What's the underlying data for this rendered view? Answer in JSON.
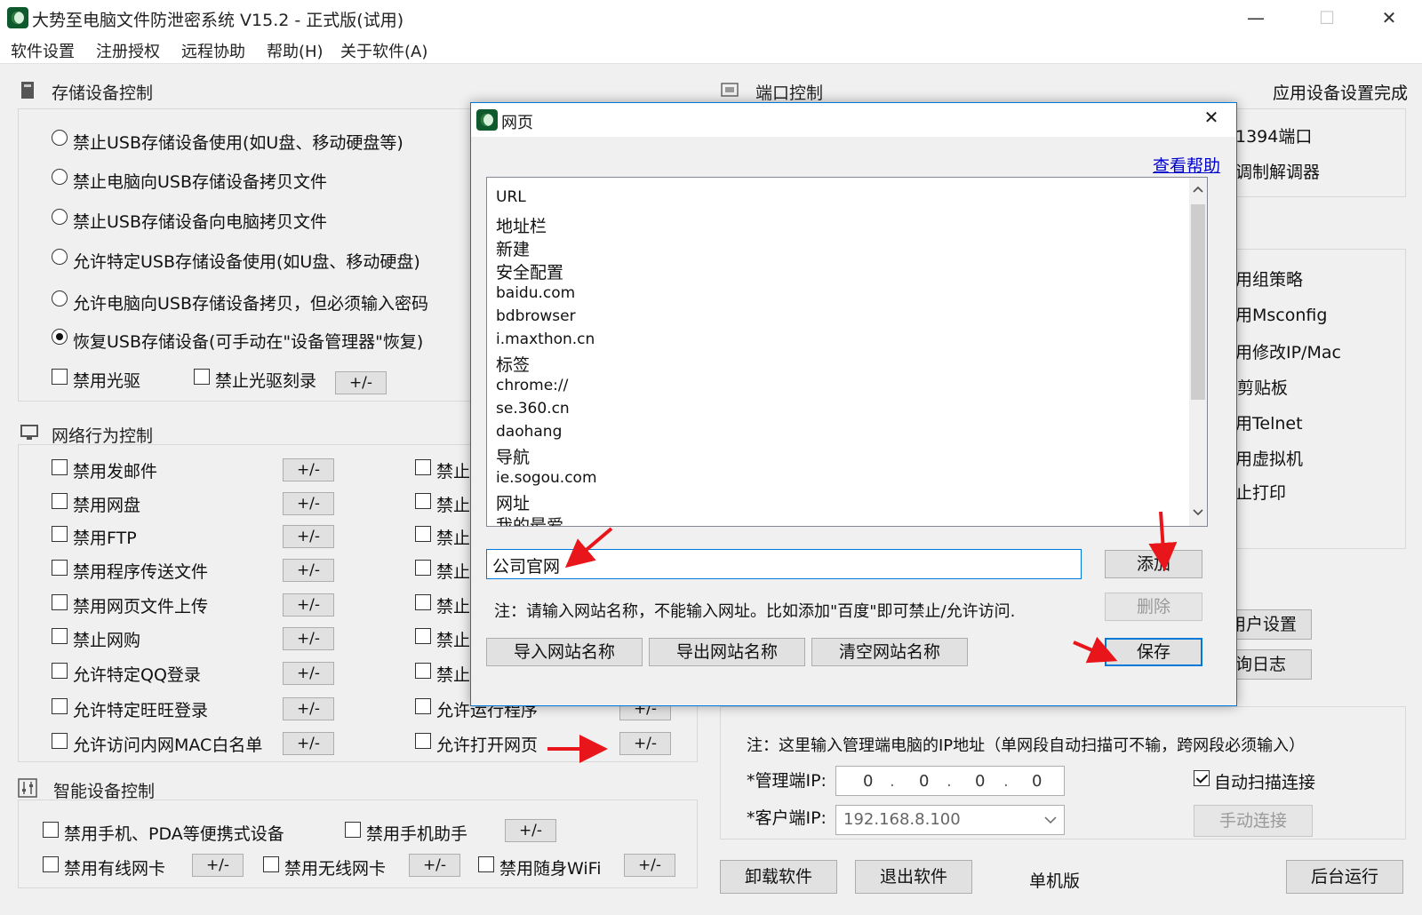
{
  "window": {
    "title": "大势至电脑文件防泄密系统 V15.2 - 正式版(试用)",
    "minimize": "—",
    "maximize": "☐",
    "close": "✕"
  },
  "menu": [
    "软件设置",
    "注册授权",
    "远程协助",
    "帮助(H)",
    "关于软件(A)"
  ],
  "storage": {
    "title": "存储设备控制",
    "options": [
      {
        "label": "禁止USB存储设备使用(如U盘、移动硬盘等)",
        "selected": false
      },
      {
        "label": "禁止电脑向USB存储设备拷贝文件",
        "selected": false
      },
      {
        "label": "禁止USB存储设备向电脑拷贝文件",
        "selected": false
      },
      {
        "label": "允许特定USB存储设备使用(如U盘、移动硬盘)",
        "selected": false
      },
      {
        "label": "允许电脑向USB存储设备拷贝，但必须输入密码",
        "selected": false
      },
      {
        "label": "恢复USB存储设备(可手动在\"设备管理器\"恢复)",
        "selected": true
      }
    ],
    "disable_cdrom": "禁用光驱",
    "disable_burn": "禁止光驱刻录",
    "pm": "+/-"
  },
  "network": {
    "title": "网络行为控制",
    "left_items": [
      "禁用发邮件",
      "禁用网盘",
      "禁用FTP",
      "禁用程序传送文件",
      "禁用网页文件上传",
      "禁止网购",
      "允许特定QQ登录",
      "允许特定旺旺登录",
      "允许访问内网MAC白名单"
    ],
    "right_prefix": "禁止",
    "right_items_last": [
      "允许运行程序",
      "允许打开网页"
    ],
    "pm": "+/-"
  },
  "smart": {
    "title": "智能设备控制",
    "row1": [
      "禁用手机、PDA等便携式设备",
      "禁用手机助手"
    ],
    "row2": [
      "禁用有线网卡",
      "禁用无线网卡",
      "禁用随身WiFi"
    ],
    "pm": "+/-"
  },
  "port": {
    "title": "端口控制",
    "status": "应用设备设置完成",
    "items": [
      "1394端口",
      "调制解调器"
    ]
  },
  "system": {
    "items": [
      "用组策略",
      "用Msconfig",
      "用修改IP/Mac",
      "剪贴板",
      "用Telnet",
      "用虚拟机",
      "止打印"
    ]
  },
  "right_buttons": [
    "用户设置",
    "询日志"
  ],
  "connect": {
    "note": "注：这里输入管理端电脑的IP地址（单网段自动扫描可不输，跨网段必须输入）",
    "admin_label": "*管理端IP:",
    "admin_ip": [
      "0",
      "0",
      "0",
      "0"
    ],
    "client_label": "*客户端IP:",
    "client_ip": "192.168.8.100",
    "auto_scan": "自动扫描连接",
    "manual": "手动连接"
  },
  "bottom": {
    "uninstall": "卸载软件",
    "exit": "退出软件",
    "mode": "单机版",
    "background": "后台运行"
  },
  "dialog": {
    "title": "网页",
    "close": "✕",
    "help_link": "查看帮助",
    "list": [
      "URL",
      "地址栏",
      "新建",
      "安全配置",
      "baidu.com",
      "bdbrowser",
      "i.maxthon.cn",
      "标签",
      "chrome://",
      "se.360.cn",
      "daohang",
      "导航",
      "ie.sogou.com",
      "网址",
      "我的最爱"
    ],
    "input_value": "公司官网",
    "note": "注：请输入网站名称，不能输入网址。比如添加\"百度\"即可禁止/允许访问.",
    "add": "添加",
    "delete": "删除",
    "save": "保存",
    "import": "导入网站名称",
    "export": "导出网站名称",
    "clear": "清空网站名称"
  },
  "colors": {
    "accent": "#0078d7",
    "annotation": "#e8161b",
    "link": "#0000cc"
  }
}
